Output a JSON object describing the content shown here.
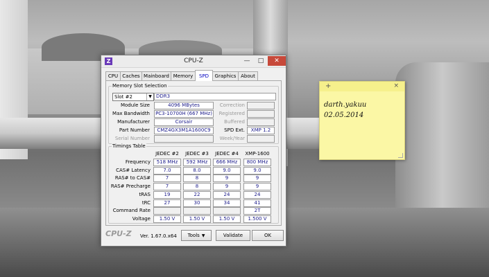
{
  "window": {
    "title": "CPU-Z",
    "icon_name": "cpuz-app-icon",
    "icon_glyph": "Z",
    "controls": {
      "minimize": "—",
      "maximize": "□",
      "close": "✕"
    }
  },
  "tabs": [
    "CPU",
    "Caches",
    "Mainboard",
    "Memory",
    "SPD",
    "Graphics",
    "About"
  ],
  "active_tab": "SPD",
  "memory_slot_selection": {
    "group_label": "Memory Slot Selection",
    "slot_value": "Slot #2",
    "slot_type": "DDR3",
    "rows": {
      "module_size": {
        "label": "Module Size",
        "value": "4096 MBytes"
      },
      "max_bandwidth": {
        "label": "Max Bandwidth",
        "value": "PC3-10700H (667 MHz)"
      },
      "manufacturer": {
        "label": "Manufacturer",
        "value": "Corsair"
      },
      "part_number": {
        "label": "Part Number",
        "value": "CMZ4GX3M1A1600C9"
      },
      "serial_number": {
        "label": "Serial Number",
        "value": ""
      }
    },
    "right_rows": {
      "correction": {
        "label": "Correction",
        "value": ""
      },
      "registered": {
        "label": "Registered",
        "value": ""
      },
      "buffered": {
        "label": "Buffered",
        "value": ""
      },
      "spd_ext": {
        "label": "SPD Ext.",
        "value": "XMP 1.2"
      },
      "week_year": {
        "label": "Week/Year",
        "value": ""
      }
    }
  },
  "timings_table": {
    "group_label": "Timings Table",
    "columns": [
      "JEDEC #2",
      "JEDEC #3",
      "JEDEC #4",
      "XMP-1600"
    ],
    "rows": [
      {
        "label": "Frequency",
        "values": [
          "518 MHz",
          "592 MHz",
          "666 MHz",
          "800 MHz"
        ]
      },
      {
        "label": "CAS# Latency",
        "values": [
          "7.0",
          "8.0",
          "9.0",
          "9.0"
        ]
      },
      {
        "label": "RAS# to CAS#",
        "values": [
          "7",
          "8",
          "9",
          "9"
        ]
      },
      {
        "label": "RAS# Precharge",
        "values": [
          "7",
          "8",
          "9",
          "9"
        ]
      },
      {
        "label": "tRAS",
        "values": [
          "19",
          "22",
          "24",
          "24"
        ]
      },
      {
        "label": "tRC",
        "values": [
          "27",
          "30",
          "34",
          "41"
        ]
      },
      {
        "label": "Command Rate",
        "values": [
          "",
          "",
          "",
          "2T"
        ]
      },
      {
        "label": "Voltage",
        "values": [
          "1.50 V",
          "1.50 V",
          "1.50 V",
          "1.500 V"
        ]
      }
    ]
  },
  "footer": {
    "brand": "CPU-Z",
    "version": "Ver. 1.67.0.x64",
    "tools_label": "Tools",
    "validate_label": "Validate",
    "ok_label": "OK"
  },
  "sticky_note": {
    "add_glyph": "+",
    "close_glyph": "×",
    "line1": "darth.yakuu",
    "line2": "02.05.2014",
    "color": "#fbf7a5"
  }
}
